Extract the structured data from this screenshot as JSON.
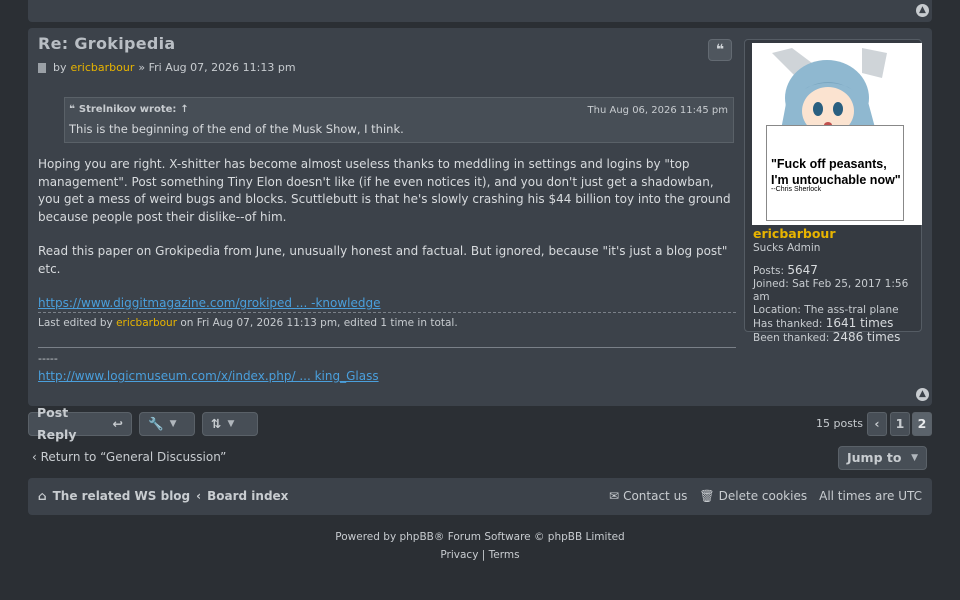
{
  "post": {
    "title": "Re: Grokipedia",
    "meta_author": "ericbarbour",
    "meta_date": "» Fri Aug 07, 2026 11:13 pm",
    "meta_by": "by",
    "quote_button": "❝",
    "quote": {
      "author": "Strelnikov wrote:",
      "arrow": "↑",
      "date": "Thu Aug 06, 2026 11:45 pm",
      "text": "This is the beginning of the end of the Musk Show, I think."
    },
    "paragraph1": "Hoping you are right. X-shitter has become almost useless thanks to meddling in settings and logins by \"top management\". Post something Tiny Elon doesn't like (if he even notices it), and you don't just get a shadowban, you get a mess of weird bugs and blocks. Scuttlebutt is that he's slowly crashing his $44 billion toy into the ground because people post their dislike--of him.",
    "paragraph2": "Read this paper on Grokipedia from June, unusually honest and factual. But ignored, because \"it's just a blog post\" etc.",
    "link": "https://www.diggitmagazine.com/grokiped ... -knowledge",
    "edit_prefix": "Last edited by",
    "edit_user": "ericbarbour",
    "edit_suffix": "on Fri Aug 07, 2026 11:13 pm, edited 1 time in total.",
    "sig_dashes": "-----",
    "sig_link": "http://www.logicmuseum.com/x/index.php/ ... king_Glass"
  },
  "profile": {
    "name": "ericbarbour",
    "rank": "Sucks Admin",
    "avatar_sign": "\"Fuck off peasants, I'm untouchable now\"",
    "avatar_attr": "--Chris Sherlock",
    "posts_label": "Posts:",
    "posts_value": "5647",
    "joined": "Joined: Sat Feb 25, 2017 1:56 am",
    "location": "Location: The ass-tral plane",
    "thanked_label": "Has thanked:",
    "thanked_value": "1641 times",
    "been_label": "Been thanked:",
    "been_value": "2486 times"
  },
  "actions": {
    "post_reply": "Post Reply",
    "posts_count": "15 posts",
    "pages": [
      "1",
      "2"
    ],
    "current_page": "2",
    "return_link": "Return to “General Discussion”",
    "jump_to": "Jump to"
  },
  "footer_nav": {
    "blog": "The related WS blog",
    "board_index": "Board index",
    "contact": "Contact us",
    "delete_cookies": "Delete cookies",
    "timezone": "All times are UTC"
  },
  "copyright": {
    "line1": "Powered by phpBB® Forum Software © phpBB Limited",
    "privacy": "Privacy",
    "sep": "|",
    "terms": "Terms"
  },
  "colors": {
    "accent_user": "#e8b400",
    "link": "#4a9fdc",
    "panel": "#3c424a",
    "background": "#2b2f34"
  }
}
